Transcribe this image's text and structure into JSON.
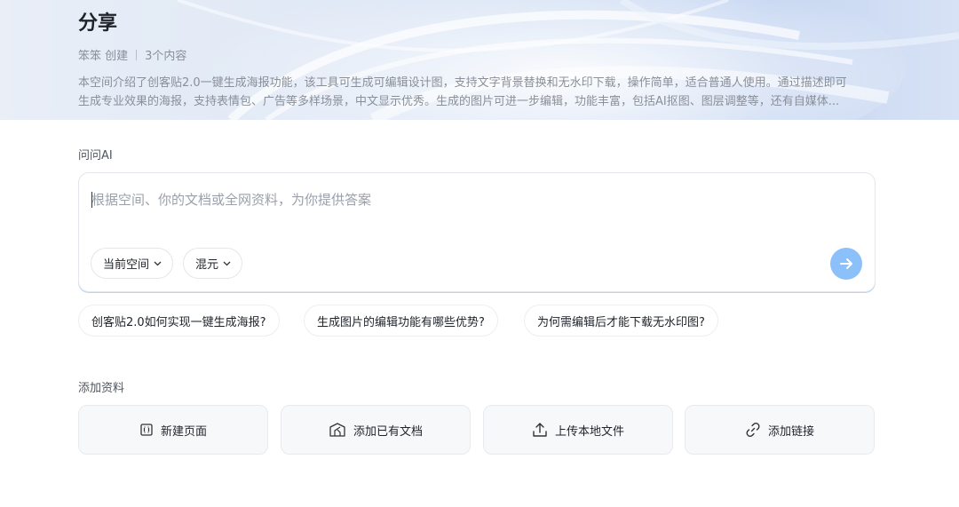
{
  "header": {
    "title": "分享",
    "author": "笨笨 创建",
    "count": "3个内容",
    "description_line1": "本空间介绍了创客贴2.0一键生成海报功能，该工具可生成可编辑设计图，支持文字背景替换和无水印下载，操作简单，适合普通人使用。通过描述即可",
    "description_line2": "生成专业效果的海报，支持表情包、广告等多样场景，中文显示优秀。生成的图片可进一步编辑，功能丰富，包括AI抠图、图层调整等，还有自媒体..."
  },
  "ask_ai": {
    "label": "问问AI",
    "placeholder": "根据空间、你的文档或全网资料，为你提供答案",
    "value": "",
    "scope_label": "当前空间",
    "model_label": "混元",
    "send_icon": "arrow-right-icon"
  },
  "suggestions": [
    "创客贴2.0如何实现一键生成海报?",
    "生成图片的编辑功能有哪些优势?",
    "为何需编辑后才能下载无水印图?"
  ],
  "add_material": {
    "label": "添加资料",
    "cards": [
      {
        "label": "新建页面",
        "icon": "new-page-icon"
      },
      {
        "label": "添加已有文档",
        "icon": "add-document-icon"
      },
      {
        "label": "上传本地文件",
        "icon": "upload-icon"
      },
      {
        "label": "添加链接",
        "icon": "link-icon"
      }
    ]
  },
  "colors": {
    "accent": "#8cc0fb",
    "text_primary": "#1f2329",
    "text_secondary": "#8a8f99",
    "card_bg": "#f7f8fa"
  }
}
